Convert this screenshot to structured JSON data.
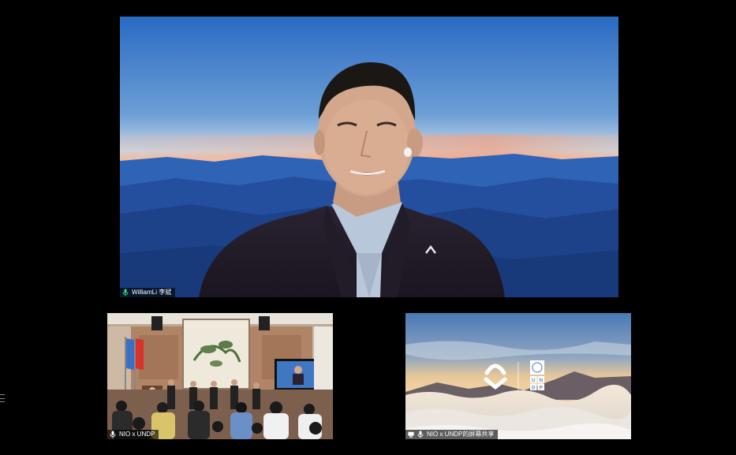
{
  "participants": {
    "main": {
      "name": "WilliamLi 李斌",
      "mic_icon": "microphone-icon",
      "mic_color": "#3ddc84"
    },
    "room": {
      "name": "NIO x UNDP",
      "mic_icon": "microphone-icon"
    },
    "share": {
      "name": "NIO x UNDP的屏幕共享",
      "share_icon": "screen-share-icon",
      "mic_icon": "microphone-icon"
    }
  },
  "share_content": {
    "logos": [
      "NIO",
      "UNDP"
    ],
    "undp_letters": [
      "U",
      "N",
      "D",
      "P"
    ]
  },
  "colors": {
    "background": "#000000",
    "sky_top": "#2f6fc4",
    "sunset": "#e7b7a0",
    "mountains": "#1f4f9a"
  },
  "side_handle_icon": "drag-handle-icon"
}
